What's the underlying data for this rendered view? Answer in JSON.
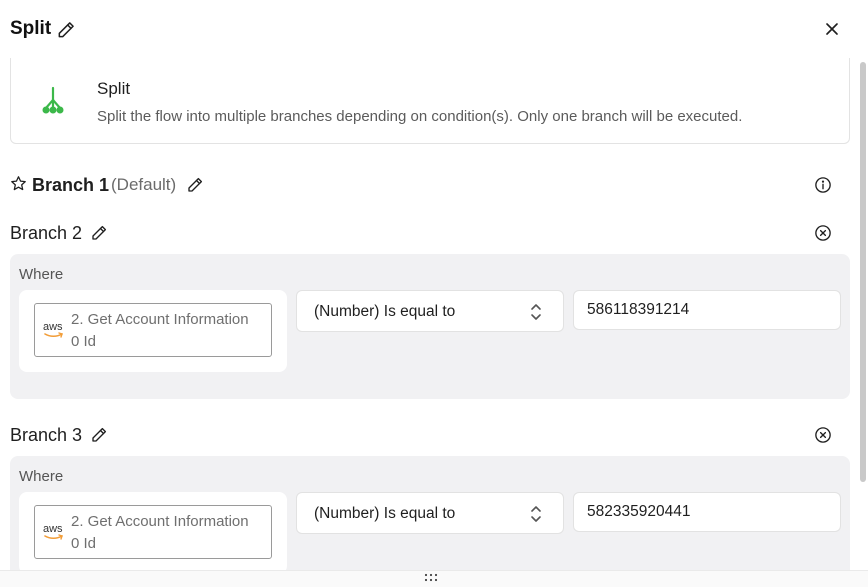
{
  "header": {
    "title": "Split",
    "icons": {
      "edit": "pencil-icon",
      "close": "close-icon"
    }
  },
  "info": {
    "title": "Split",
    "description": "Split the flow into multiple branches depending on condition(s). Only one branch will be executed.",
    "icon": "split-branch-icon",
    "icon_color": "#3cb84a"
  },
  "branches": [
    {
      "name": "Branch 1",
      "tag": "(Default)",
      "icons": [
        "star-icon",
        "pencil-icon",
        "info-icon"
      ]
    },
    {
      "name": "Branch 2",
      "where_label": "Where",
      "field_line1": "2. Get Account Information",
      "field_line2": "0 Id",
      "field_icon": "aws-icon",
      "operator": "(Number) Is equal to",
      "value": "586118391214",
      "icons": [
        "pencil-icon",
        "remove-circle-icon",
        "select-chevron-icon"
      ]
    },
    {
      "name": "Branch 3",
      "where_label": "Where",
      "field_line1": "2. Get Account Information",
      "field_line2": "0 Id",
      "field_icon": "aws-icon",
      "operator": "(Number) Is equal to",
      "value": "582335920441",
      "icons": [
        "pencil-icon",
        "remove-circle-icon",
        "select-chevron-icon"
      ]
    }
  ],
  "footer": {
    "icon": "drag-handle-icon"
  },
  "colors": {
    "accent": "#3cb84a",
    "panel_bg": "#f1f1f3",
    "aws_orange": "#f29d38"
  }
}
